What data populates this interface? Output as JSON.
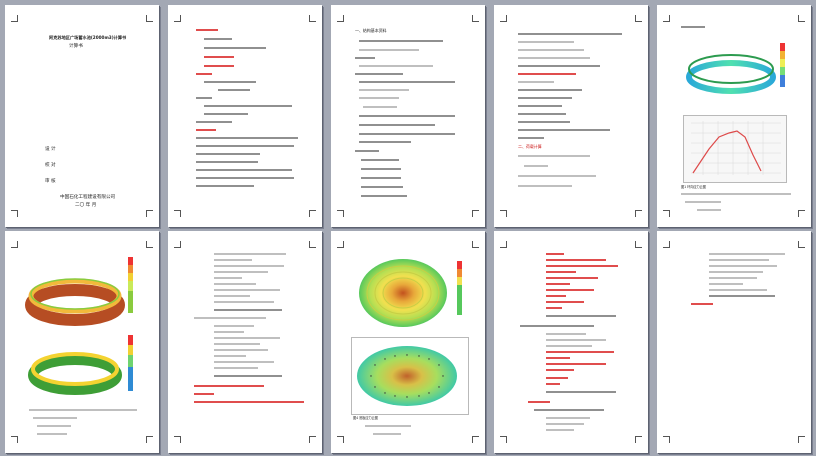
{
  "document": {
    "cover": {
      "title": "阿克苏地区广场蓄水池(2000m3)计算书",
      "subtitle": "计算书",
      "label_design": "设 计",
      "label_check": "校 对",
      "label_review": "审 核",
      "institute": "中国石化工程建设有限公司",
      "date": "二〇 年 月"
    },
    "page3": {
      "heading": "一、结构基本资料"
    },
    "page4": {
      "section": "二、荷载计算"
    },
    "page5": {
      "caption": "图1 环向应力云图"
    },
    "page9": {
      "caption": "图4 底板应力云图"
    }
  },
  "colors": {
    "viewer_background": "#a3a8b4",
    "page_background": "#ffffff",
    "text_red": "#cc1b1b",
    "text_dark": "#222222"
  }
}
